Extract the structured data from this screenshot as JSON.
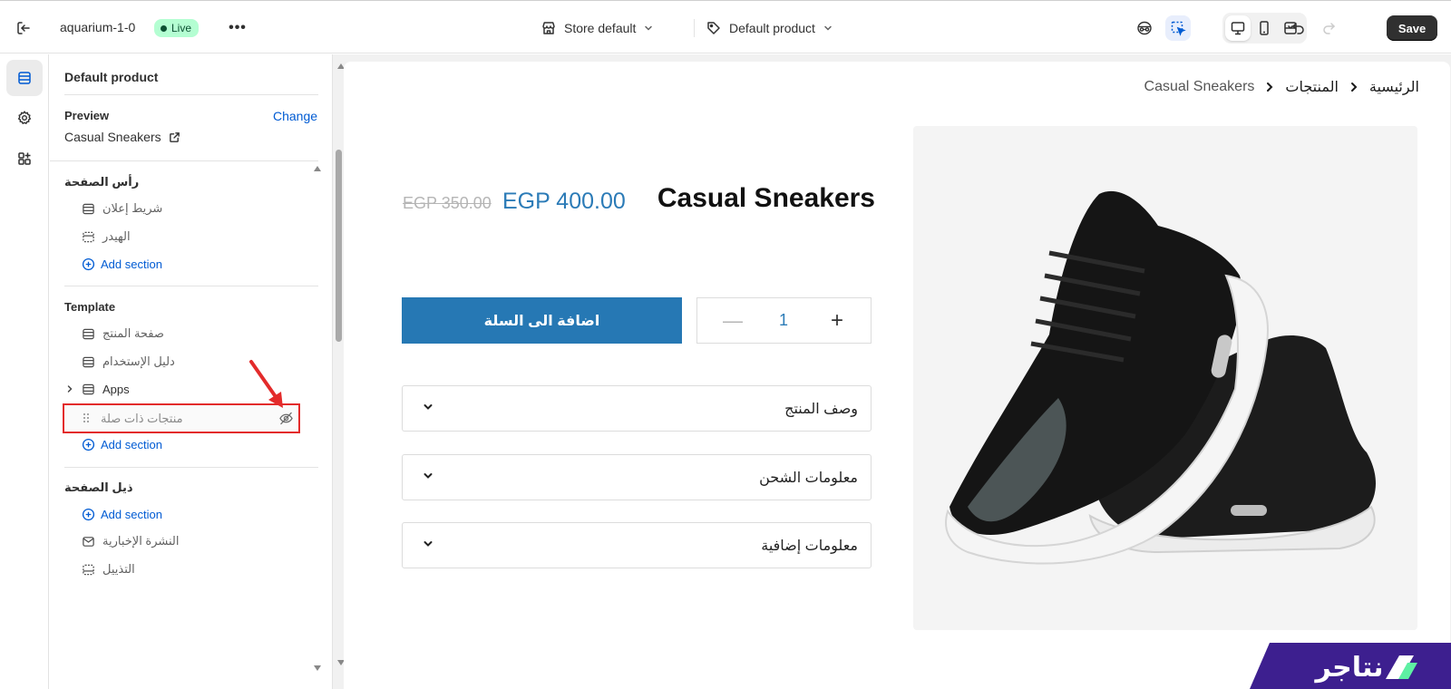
{
  "topbar": {
    "store_name": "aquarium-1-0",
    "live_label": "Live",
    "store_selector": "Store default",
    "template_selector": "Default product",
    "save_label": "Save"
  },
  "sidebar": {
    "title": "Default product",
    "preview": {
      "label": "Preview",
      "change_label": "Change",
      "value": "Casual Sneakers"
    },
    "header_group": {
      "title": "رأس الصفحة",
      "items": [
        "شريط إعلان",
        "الهيدر"
      ],
      "add_section": "Add section"
    },
    "template_group": {
      "title": "Template",
      "items": [
        "صفحة المنتج",
        "دليل الإستخدام",
        "Apps"
      ],
      "hidden_item": "منتجات ذات صلة",
      "add_section": "Add section"
    },
    "footer_group": {
      "title": "ذيل الصفحة",
      "add_section": "Add section",
      "items": [
        "النشرة الإخبارية",
        "التذييل"
      ]
    }
  },
  "preview": {
    "breadcrumb": [
      "الرئيسية",
      "المنتجات",
      "Casual Sneakers"
    ],
    "product_title": "Casual Sneakers",
    "price": "EGP 400.00",
    "compare_price": "EGP 350.00",
    "add_to_cart": "اضافة الى السلة",
    "quantity": "1",
    "accordions": [
      "وصف المنتج",
      "معلومات الشحن",
      "معلومات إضافية"
    ]
  },
  "brand": {
    "name": "نتاجر",
    "color": "#3d1f8f",
    "accent": "#5ef0a3"
  },
  "colors": {
    "accent": "#005bd3",
    "annotation": "#e32b2b",
    "primary_button": "#2678b4"
  }
}
